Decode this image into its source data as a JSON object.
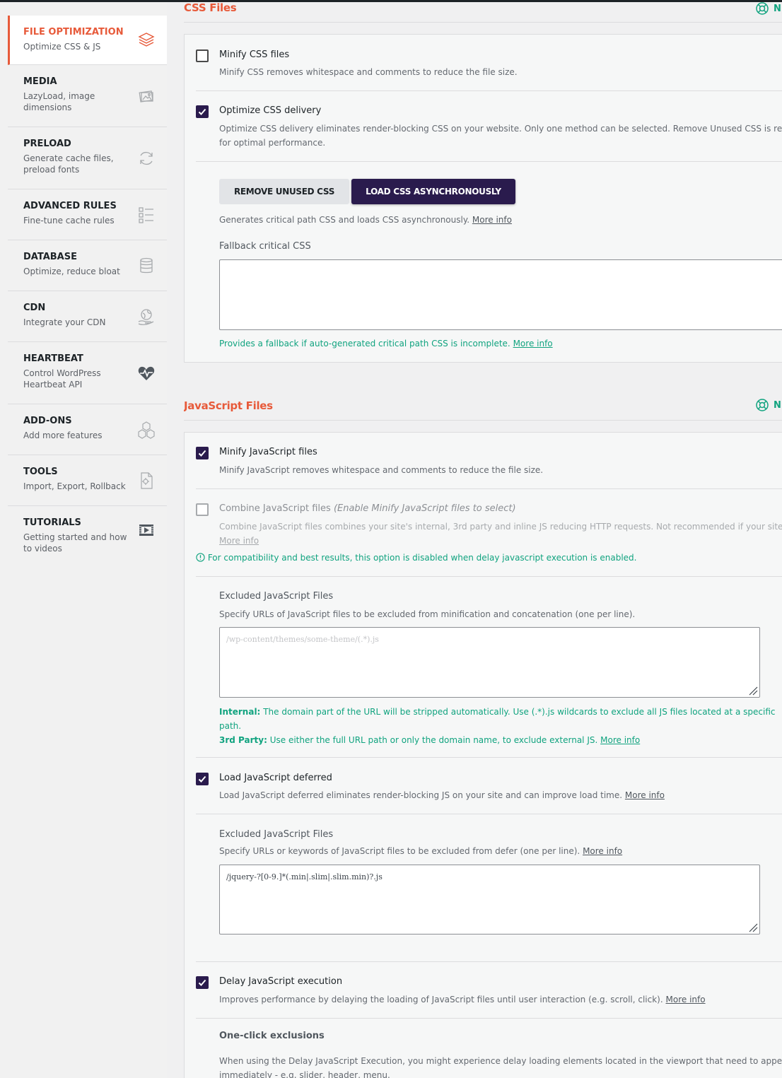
{
  "sidebar": {
    "items": [
      {
        "title": "FILE OPTIMIZATION",
        "sub": "Optimize CSS & JS",
        "icon": "layers-icon"
      },
      {
        "title": "MEDIA",
        "sub": "LazyLoad, image dimensions",
        "icon": "images-icon"
      },
      {
        "title": "PRELOAD",
        "sub": "Generate cache files, preload fonts",
        "icon": "refresh-icon"
      },
      {
        "title": "ADVANCED RULES",
        "sub": "Fine-tune cache rules",
        "icon": "checklist-icon"
      },
      {
        "title": "DATABASE",
        "sub": "Optimize, reduce bloat",
        "icon": "database-icon"
      },
      {
        "title": "CDN",
        "sub": "Integrate your CDN",
        "icon": "globe-hand-icon"
      },
      {
        "title": "HEARTBEAT",
        "sub": "Control WordPress Heartbeat API",
        "icon": "heartbeat-icon"
      },
      {
        "title": "ADD-ONS",
        "sub": "Add more features",
        "icon": "cubes-icon"
      },
      {
        "title": "TOOLS",
        "sub": "Import, Export, Rollback",
        "icon": "tools-file-icon"
      },
      {
        "title": "TUTORIALS",
        "sub": "Getting started and how to videos",
        "icon": "video-icon"
      }
    ]
  },
  "css_section": {
    "title": "CSS Files",
    "help_label": "N",
    "minify": {
      "label": "Minify CSS files",
      "desc": "Minify CSS removes whitespace and comments to reduce the file size.",
      "checked": false
    },
    "optimize": {
      "label": "Optimize CSS delivery",
      "desc_line1": "Optimize CSS delivery eliminates render-blocking CSS on your website. Only one method can be selected. Remove Unused CSS is recomme",
      "desc_line2": "for optimal performance.",
      "checked": true
    },
    "btn_remove": "REMOVE UNUSED CSS",
    "btn_async": "LOAD CSS ASYNCHRONOUSLY",
    "async_desc": "Generates critical path CSS and loads CSS asynchronously.",
    "more_info": "More info",
    "fallback_label": "Fallback critical CSS",
    "fallback_value": "",
    "fallback_note": "Provides a fallback if auto-generated critical path CSS is incomplete."
  },
  "js_section": {
    "title": "JavaScript Files",
    "help_label": "N",
    "minify": {
      "label": "Minify JavaScript files",
      "desc": "Minify JavaScript removes whitespace and comments to reduce the file size.",
      "checked": true
    },
    "combine": {
      "label": "Combine JavaScript files",
      "label_note": "(Enable Minify JavaScript files to select)",
      "desc": "Combine JavaScript files combines your site's internal, 3rd party and inline JS reducing HTTP requests. Not recommended if your site uses H",
      "more_info": "More info",
      "warning": "For compatibility and best results, this option is disabled when delay javascript execution is enabled.",
      "checked": false
    },
    "excluded1": {
      "label": "Excluded JavaScript Files",
      "desc": "Specify URLs of JavaScript files to be excluded from minification and concatenation (one per line).",
      "placeholder": "/wp-content/themes/some-theme/(.*).js",
      "internal_label": "Internal:",
      "internal_text": "The domain part of the URL will be stripped automatically. Use (.*).js wildcards to exclude all JS files located at a specific",
      "internal_text2": "path.",
      "third_label": "3rd Party:",
      "third_text": "Use either the full URL path or only the domain name, to exclude external JS.",
      "more_info": "More info"
    },
    "defer": {
      "label": "Load JavaScript deferred",
      "desc": "Load JavaScript deferred eliminates render-blocking JS on your site and can improve load time.",
      "more_info": "More info",
      "checked": true
    },
    "excluded2": {
      "label": "Excluded JavaScript Files",
      "desc": "Specify URLs or keywords of JavaScript files to be excluded from defer (one per line).",
      "more_info": "More info",
      "value": "/jquery-?[0-9.]*(.min|.slim|.slim.min)?.js"
    },
    "delay": {
      "label": "Delay JavaScript execution",
      "desc": "Improves performance by delaying the loading of JavaScript files until user interaction (e.g. scroll, click).",
      "more_info": "More info",
      "checked": true
    },
    "oneclick": {
      "label": "One-click exclusions",
      "desc1": "When using the Delay JavaScript Execution, you might experience delay loading elements located in the viewport that need to appear",
      "desc2": "immediately - e.g. slider, header, menu."
    }
  },
  "colors": {
    "accent": "#e75a3a",
    "dark": "#2a1b4d",
    "green": "#10a37f"
  }
}
